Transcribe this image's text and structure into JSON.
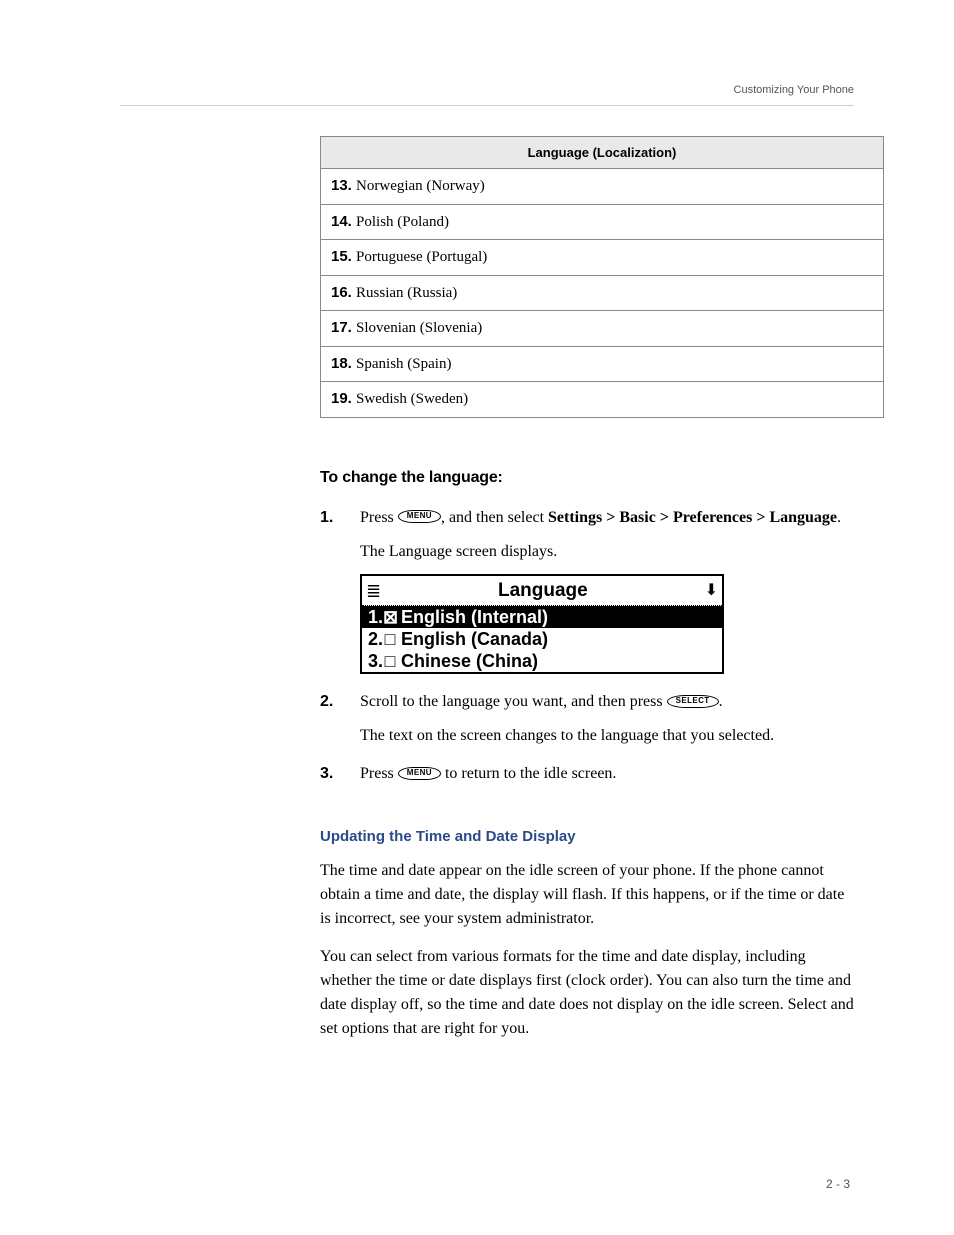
{
  "runningHead": "Customizing Your Phone",
  "table": {
    "header": "Language (Localization)",
    "rows": [
      {
        "num": "13.",
        "text": "Norwegian (Norway)"
      },
      {
        "num": "14.",
        "text": "Polish (Poland)"
      },
      {
        "num": "15.",
        "text": "Portuguese (Portugal)"
      },
      {
        "num": "16.",
        "text": "Russian (Russia)"
      },
      {
        "num": "17.",
        "text": "Slovenian (Slovenia)"
      },
      {
        "num": "18.",
        "text": "Spanish (Spain)"
      },
      {
        "num": "19.",
        "text": "Swedish (Sweden)"
      }
    ]
  },
  "sectionHeading": "To change the language:",
  "steps": {
    "s1": {
      "num": "1.",
      "lead": "Press ",
      "menuKey": "MENU",
      "mid": ", and then select ",
      "pathParts": [
        "Settings",
        "Basic",
        "Preferences",
        "Language"
      ],
      "tail": ".",
      "sep": " > ",
      "result": "The Language screen displays."
    },
    "s2": {
      "num": "2.",
      "lead": "Scroll to the language you want, and then press ",
      "selectKey": "SELECT",
      "tail": ".",
      "result": "The text on the screen changes to the language that you selected."
    },
    "s3": {
      "num": "3.",
      "lead": "Press ",
      "menuKey": "MENU",
      "tail": " to return to the idle screen."
    }
  },
  "lcd": {
    "title": "Language",
    "leftIcon": "≣",
    "rightIcon": "⬇",
    "items": [
      {
        "index": "1",
        "mark": "⊠",
        "label": "English (Internal)",
        "selected": true
      },
      {
        "index": "2",
        "mark": "□",
        "label": "English (Canada)",
        "selected": false
      },
      {
        "index": "3",
        "mark": "□",
        "label": "Chinese (China)",
        "selected": false
      }
    ]
  },
  "subHeading": "Updating the Time and Date Display",
  "para1": "The time and date appear on the idle screen of your phone. If the phone cannot obtain a time and date, the display will flash. If this happens, or if the time or date is incorrect, see your system administrator.",
  "para2": "You can select from various formats for the time and date display, including whether the time or date displays first (clock order). You can also turn the time and date display off, so the time and date does not display on the idle screen. Select and set options that are right for you.",
  "pageNumber": "2 - 3"
}
